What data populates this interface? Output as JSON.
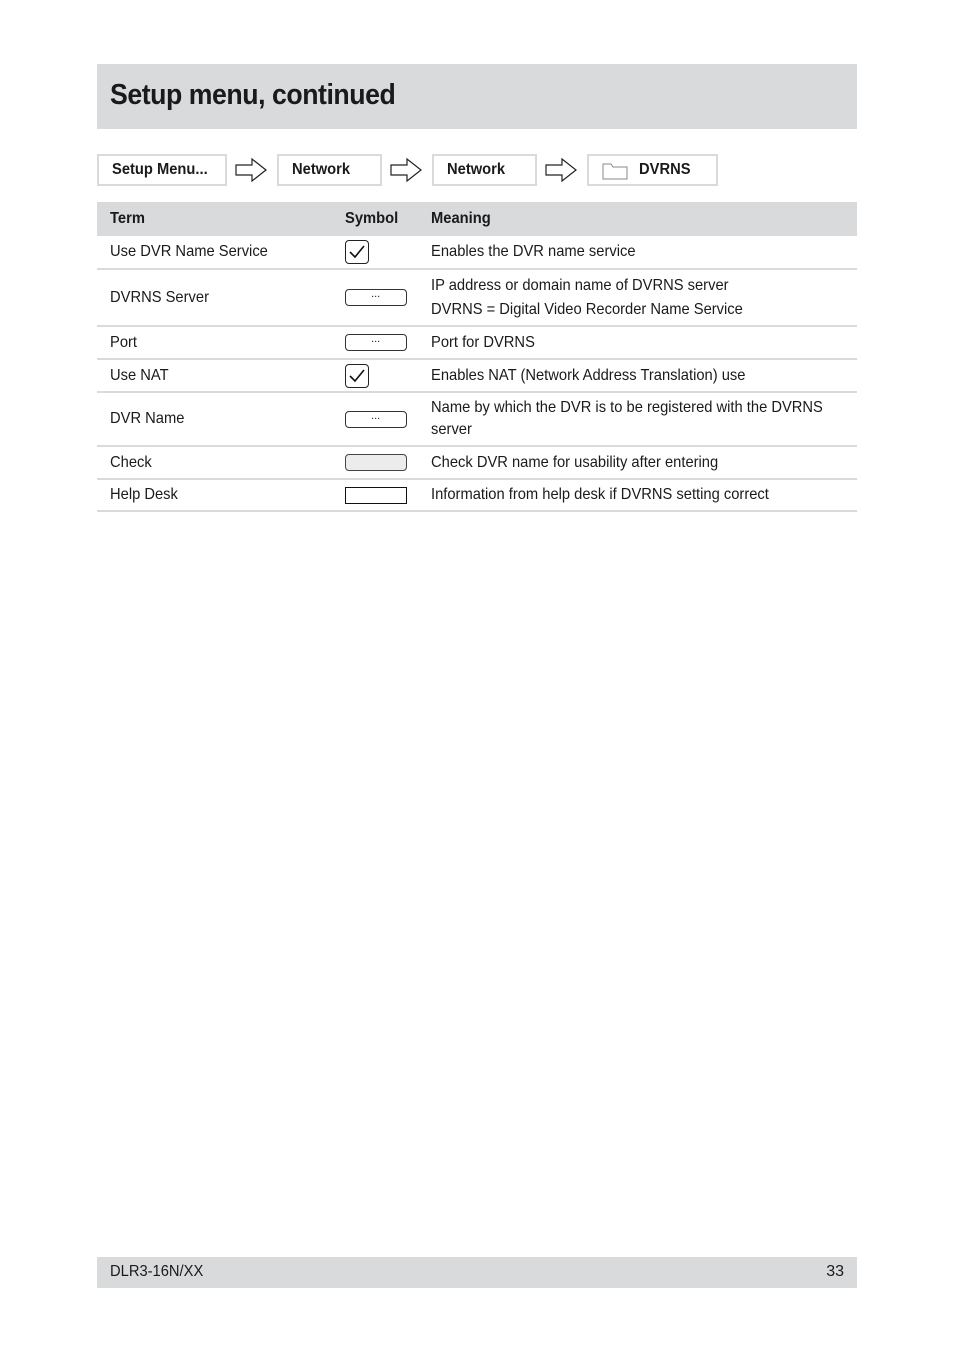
{
  "page": {
    "title": "Setup menu, continued"
  },
  "breadcrumb": [
    {
      "label": "Setup Menu...",
      "icon": null
    },
    {
      "label": "Network",
      "icon": null
    },
    {
      "label": "Network",
      "icon": null
    },
    {
      "label": "DVRNS",
      "icon": "folder-icon"
    }
  ],
  "breadcrumb_separator_icon": "arrow-right-outline-icon",
  "table": {
    "headers": {
      "term": "Term",
      "symbol": "Symbol",
      "meaning": "Meaning"
    },
    "rows": [
      {
        "term": "Use DVR Name Service",
        "symbol": "checkbox-checked",
        "meaning": [
          "Enables the DVR name service"
        ]
      },
      {
        "term": "DVRNS Server",
        "symbol": "input-field-ellipsis",
        "symbol_text": "...",
        "meaning": [
          "IP address or domain name of DVRNS server",
          "DVRNS = Digital Video Recorder Name Service"
        ]
      },
      {
        "term": "Port",
        "symbol": "input-field-ellipsis",
        "symbol_text": "...",
        "meaning": [
          "Port for DVRNS"
        ]
      },
      {
        "term": "Use NAT",
        "symbol": "checkbox-checked",
        "meaning": [
          "Enables NAT (Network Address Translation) use"
        ]
      },
      {
        "term": "DVR Name",
        "symbol": "input-field-ellipsis",
        "symbol_text": "...",
        "meaning": [
          "Name by which the DVR is to be registered with the DVRNS",
          "server"
        ]
      },
      {
        "term": "Check",
        "symbol": "button-blank",
        "meaning": [
          "Check DVR name for usability after entering"
        ]
      },
      {
        "term": "Help Desk",
        "symbol": "display-box",
        "meaning": [
          "Information from help desk if DVRNS setting correct"
        ]
      }
    ]
  },
  "footer": {
    "model": "DLR3-16N/XX",
    "page_number": "33"
  },
  "colors": {
    "band_gray": "#d9dadb",
    "text": "#1a1a1a"
  }
}
